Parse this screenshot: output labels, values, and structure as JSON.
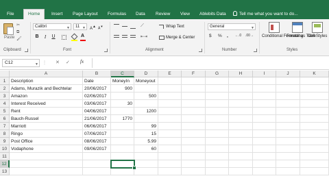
{
  "tabs": [
    "File",
    "Home",
    "Insert",
    "Page Layout",
    "Formulas",
    "Data",
    "Review",
    "View",
    "Ablebits Data"
  ],
  "active_tab": "Home",
  "tell_me": "Tell me what you want to do...",
  "ribbon": {
    "clipboard": {
      "paste": "Paste",
      "label": "Clipboard"
    },
    "font": {
      "name": "Calibri",
      "size": "11",
      "bold": "B",
      "italic": "I",
      "underline": "U",
      "font_color": "A",
      "label": "Font"
    },
    "alignment": {
      "wrap_text": "Wrap Text",
      "merge_center": "Merge & Center",
      "label": "Alignment"
    },
    "number": {
      "format": "General",
      "currency": "$",
      "percent": "%",
      "comma": ",",
      "label": "Number"
    },
    "styles": {
      "conditional": "Conditional Formatting",
      "format_table": "Format as Table",
      "cell_styles": "Cell Styles",
      "label": "Styles"
    }
  },
  "formula_bar": {
    "name_box": "C12",
    "content": ""
  },
  "columns": [
    "A",
    "B",
    "C",
    "D",
    "E",
    "F",
    "G",
    "H",
    "I",
    "J",
    "K"
  ],
  "rows": [
    [
      "Description",
      "Date",
      "MoneyIn",
      "Moneyout"
    ],
    [
      "Adams, Murazik and Bechtelar",
      "20/06/2017",
      "900",
      ""
    ],
    [
      "Amazon",
      "02/06/2017",
      "",
      "500"
    ],
    [
      "Interest Received",
      "03/06/2017",
      "30",
      ""
    ],
    [
      "Rent",
      "04/06/2017",
      "",
      "1200"
    ],
    [
      "Bauch-Russel",
      "21/06/2017",
      "1770",
      ""
    ],
    [
      "Marriott",
      "06/06/2017",
      "",
      "99"
    ],
    [
      "Ringo",
      "07/06/2017",
      "",
      "15"
    ],
    [
      "Post Office",
      "08/06/2017",
      "",
      "5.99"
    ],
    [
      "Vodaphone",
      "09/06/2017",
      "",
      "60"
    ],
    [
      "",
      "",
      "",
      ""
    ],
    [
      "",
      "",
      "",
      ""
    ],
    [
      "",
      "",
      "",
      ""
    ]
  ],
  "selected_cell": "C12",
  "colors": {
    "excel_green": "#217346",
    "selection": "#217346"
  }
}
